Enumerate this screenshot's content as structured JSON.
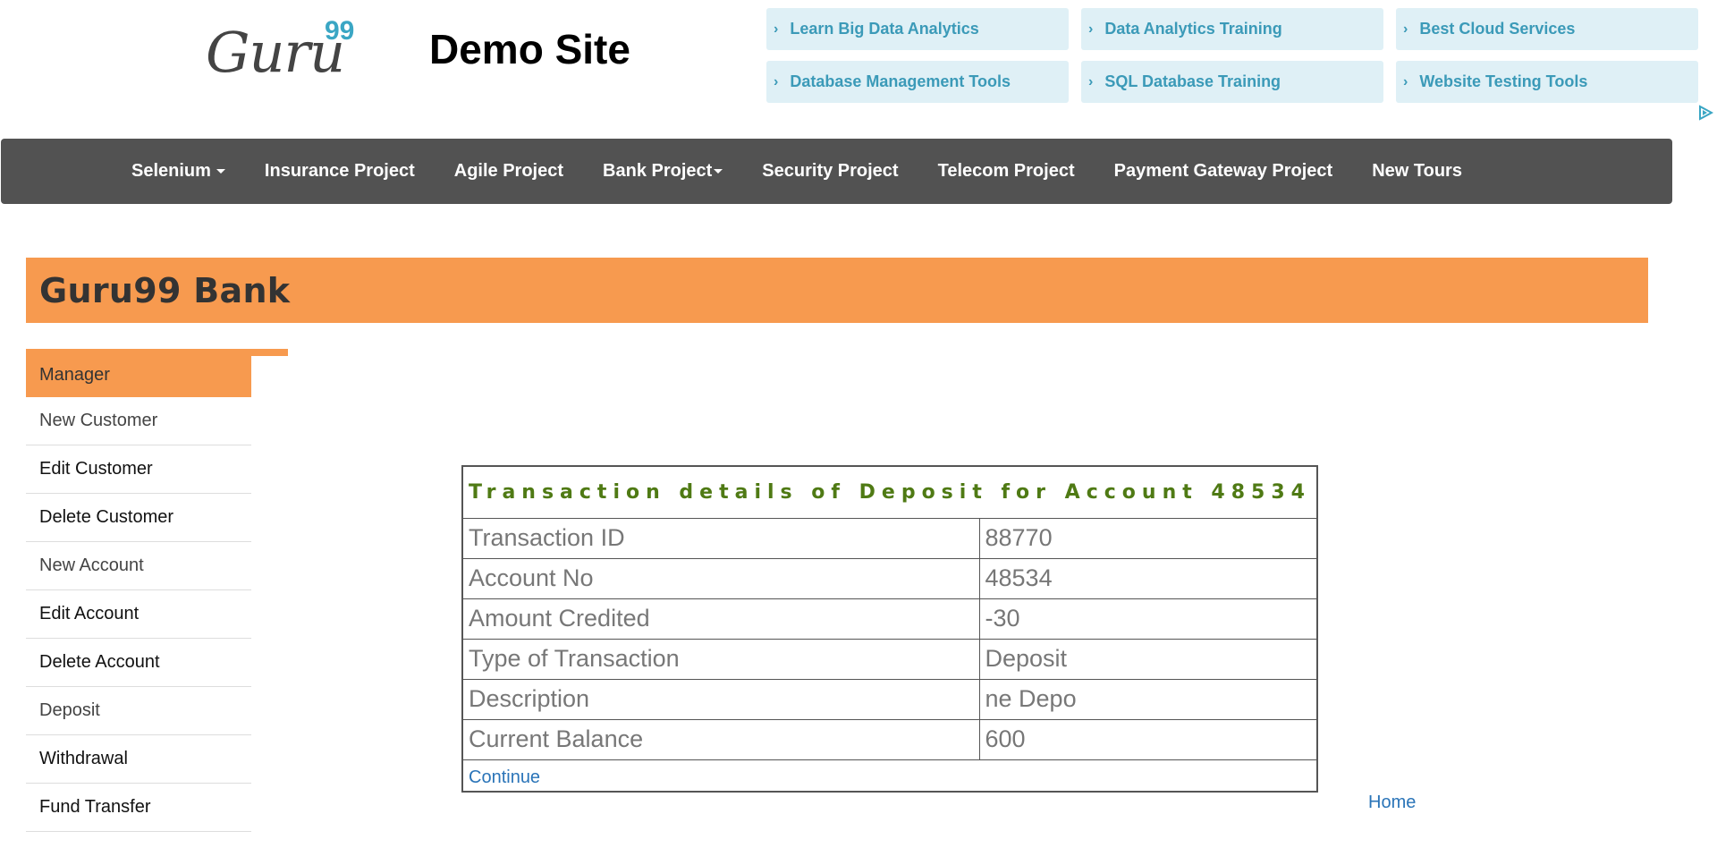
{
  "header": {
    "logo_text": "Guru",
    "logo_superscript": "99",
    "site_title": "Demo Site"
  },
  "ads": {
    "links": [
      "Learn Big Data Analytics",
      "Data Analytics Training",
      "Best Cloud Services",
      "Database Management Tools",
      "SQL Database Training",
      "Website Testing Tools"
    ],
    "chevron": "›",
    "adchoices_icon": "adchoices-triangle-icon"
  },
  "navbar": {
    "items": [
      "Selenium",
      "Insurance Project",
      "Agile Project",
      "Bank Project",
      "Security Project",
      "Telecom Project",
      "Payment Gateway Project",
      "New Tours"
    ]
  },
  "bank": {
    "title": "Guru99 Bank"
  },
  "menu": {
    "header": "Manager",
    "items": [
      "New Customer",
      "Edit Customer",
      "Delete Customer",
      "New Account",
      "Edit Account",
      "Delete Account",
      "Deposit",
      "Withdrawal",
      "Fund Transfer"
    ]
  },
  "transaction": {
    "title": "Transaction details of Deposit for Account 48534",
    "rows": [
      {
        "label": "Transaction ID",
        "value": "88770"
      },
      {
        "label": "Account No",
        "value": "48534"
      },
      {
        "label": "Amount Credited",
        "value": "-30"
      },
      {
        "label": "Type of Transaction",
        "value": "Deposit"
      },
      {
        "label": "Description",
        "value": "ne Depo"
      },
      {
        "label": "Current Balance",
        "value": "600"
      }
    ],
    "continue_label": "Continue"
  },
  "footer": {
    "home_label": "Home"
  },
  "colors": {
    "orange": "#f79a4f",
    "navbar": "#525252",
    "ad_background": "#dff0f6",
    "ad_text": "#3b9ab8",
    "title_green": "#4f7a14",
    "link_blue": "#2a74b8"
  }
}
